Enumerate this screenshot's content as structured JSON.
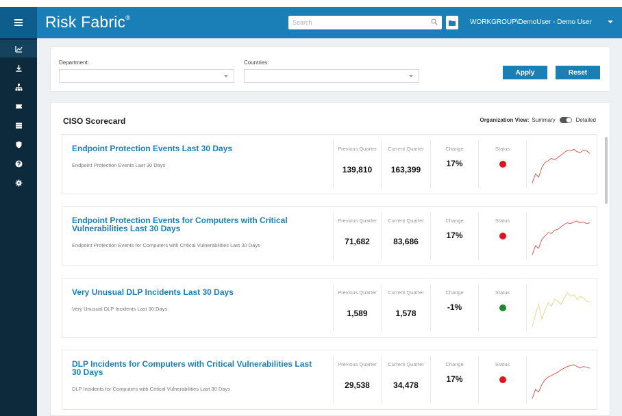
{
  "app": {
    "brand": "Risk Fabric",
    "brand_mark": "®",
    "search_placeholder": "Search",
    "user": "WORKGROUP\\DemoUser - Demo User"
  },
  "sidebar": {
    "items": [
      {
        "icon": "chart-line-icon",
        "active": true
      },
      {
        "icon": "download-icon",
        "active": false
      },
      {
        "icon": "sitemap-icon",
        "active": false
      },
      {
        "icon": "ticket-icon",
        "active": false
      },
      {
        "icon": "server-icon",
        "active": false
      },
      {
        "icon": "shield-icon",
        "active": false
      },
      {
        "icon": "help-icon",
        "active": false
      },
      {
        "icon": "gear-icon",
        "active": false
      }
    ]
  },
  "filters": {
    "department_label": "Department:",
    "department_value": "",
    "countries_label": "Countries:",
    "countries_value": "",
    "apply_label": "Apply",
    "reset_label": "Reset"
  },
  "scorecard": {
    "title": "CISO Scorecard",
    "org_view_label": "Organization View:",
    "summary_label": "Summary",
    "detailed_label": "Detailed",
    "previous_label": "Previous Quarter",
    "current_label": "Current Quarter",
    "change_label": "Change",
    "status_label": "Status",
    "cards": [
      {
        "title": "Endpoint Protection Events Last 30 Days",
        "description": "Endpoint Protection Events Last 30 Days",
        "previous": "139,810",
        "current": "163,399",
        "change": "17%",
        "status": "red",
        "spark_color": "#e05a4f",
        "spark": [
          3,
          14,
          10,
          22,
          28,
          30,
          33,
          31,
          34,
          37,
          40,
          43,
          42,
          44,
          41,
          40,
          43,
          42,
          39
        ]
      },
      {
        "title": "Endpoint Protection Events for Computers with Critical Vulnerabilities Last 30 Days",
        "description": "Endpoint Protection Events for Computers with Critical Vulnerabilities Last 30 Days",
        "previous": "71,682",
        "current": "83,686",
        "change": "17%",
        "status": "red",
        "spark_color": "#e05a4f",
        "spark": [
          3,
          14,
          11,
          22,
          26,
          30,
          29,
          33,
          34,
          37,
          40,
          42,
          41,
          43,
          44,
          42,
          43,
          41,
          42
        ]
      },
      {
        "title": "Very Unusual DLP Incidents Last 30 Days",
        "description": "Very Unusual DLP Incidents Last 30 Days",
        "previous": "1,589",
        "current": "1,578",
        "change": "-1%",
        "status": "green",
        "spark_color": "#e7d98a",
        "spark": [
          3,
          18,
          30,
          12,
          24,
          32,
          28,
          36,
          34,
          30,
          38,
          44,
          40,
          42,
          36,
          40,
          38,
          34,
          33
        ]
      },
      {
        "title": "DLP Incidents for Computers with Critical Vulnerabilities Last 30 Days",
        "description": "DLP Incidents for Computers with Critical Vulnerabilities Last 30 Days",
        "previous": "29,538",
        "current": "34,478",
        "change": "17%",
        "status": "red",
        "spark_color": "#e05a4f",
        "spark": [
          3,
          14,
          11,
          20,
          26,
          29,
          31,
          33,
          35,
          38,
          40,
          42,
          43,
          44,
          42,
          40,
          42,
          41,
          40
        ]
      }
    ]
  },
  "colors": {
    "accent": "#1b7fb7",
    "sidebar": "#0c2a3c",
    "status_red": "#e0121f",
    "status_green": "#1e8a2f"
  }
}
